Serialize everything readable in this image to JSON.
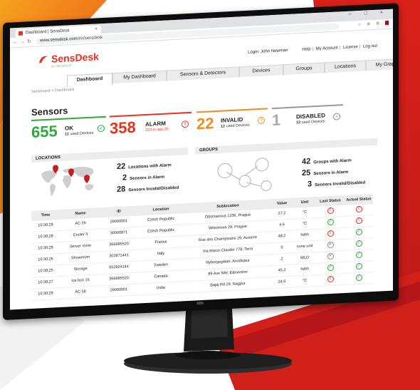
{
  "browser": {
    "tab_title": "Dashboard | SensDesk",
    "url_host": "www.sensdesk.com",
    "url_path": "/en/sensdesk",
    "window_controls": "– □ ×",
    "extensions": "☆ ⊕ ⚙"
  },
  "header": {
    "brand": "SensDesk",
    "tagline": "BY HW GROUP",
    "login_text": "Login: John Newman",
    "links": [
      "Help",
      "My Account",
      "License",
      "Log out"
    ]
  },
  "tabs": [
    "Dashboard",
    "My Dashboard",
    "Sensors & Detectors",
    "Devices",
    "Groups",
    "Locations",
    "My Graph"
  ],
  "breadcrumb": "Sensboard > Dashboard",
  "sensors": {
    "title": "Sensors",
    "ok": {
      "count": "655",
      "label": "OK",
      "sub_num": "11",
      "sub_text": "used Devices"
    },
    "alarm": {
      "count": "358",
      "label": "ALARM",
      "sub": "223 in last 2h"
    },
    "invalid": {
      "count": "22",
      "label": "INVALID",
      "sub_num": "12",
      "sub_text": "used Devices"
    },
    "disabled": {
      "count": "1",
      "label": "DISABLED",
      "sub_num": "12",
      "sub_text": "used Devices"
    }
  },
  "locations": {
    "title": "LOCATIONS",
    "stats": [
      {
        "n": "22",
        "text": "Locations with Alarm"
      },
      {
        "n": "2",
        "text": "Sensors in Alarm"
      },
      {
        "n": "28",
        "text": "Sensors Invalid/Disabled"
      }
    ]
  },
  "groups": {
    "title": "GROUPS",
    "stats": [
      {
        "n": "42",
        "text": "Groups with Alarm"
      },
      {
        "n": "25",
        "text": "Sensors in Alarm"
      },
      {
        "n": "3",
        "text": "Sensors Invalid/Disabled"
      }
    ]
  },
  "table": {
    "columns": [
      "Time",
      "Name",
      "ID",
      "Location",
      "Sublocation",
      "Value",
      "Unit",
      "Last Status",
      "Actual Status"
    ],
    "rows": [
      {
        "time": "10:30:29",
        "name": "AC 59",
        "id": "29000001",
        "location": "Czech Republic",
        "sub": "Ottomanova 1336, Prague",
        "value": "27.2",
        "unit": "°C",
        "last": "alarm",
        "actual": "alarm"
      },
      {
        "time": "10:30:28",
        "name": "Cooler 5",
        "id": "30000871",
        "location": "Czech Republic",
        "sub": "Wilsonova 29, Prague",
        "value": "4.6",
        "unit": "°C",
        "last": "ok",
        "actual": "alarm"
      },
      {
        "time": "10:30:29",
        "name": "Server room",
        "id": "366985520",
        "location": "France",
        "sub": "Rue des Champsians 29, Auxerre",
        "value": "48.2",
        "unit": "%Rh",
        "last": "alarm",
        "actual": "ok"
      },
      {
        "time": "10:30:26",
        "name": "Showroom",
        "id": "302871441",
        "location": "Italy",
        "sub": "Via Marco Claudio 778, Terni",
        "value": "0",
        "unit": "none unit",
        "last": "disabled",
        "actual": "ok"
      },
      {
        "time": "10:30:25",
        "name": "Storage",
        "id": "652924144",
        "location": "Sweden",
        "sub": "Nyborgsgatan, Arvidsjaur",
        "value": "2",
        "unit": "WLD",
        "last": "disabled",
        "actual": "ok"
      },
      {
        "time": "10:30:27",
        "name": "Ice box 15",
        "id": "366985520",
        "location": "Canada",
        "sub": "89 Ave NW, Edmonton",
        "value": "45.3",
        "unit": "%Rh",
        "last": "ok",
        "actual": "ok"
      },
      {
        "time": "10:30:29",
        "name": "AC 58",
        "id": "29000001",
        "location": "India",
        "sub": "Bajaj Rd 29, Nagpur",
        "value": "24.6",
        "unit": "°C",
        "last": "alarm",
        "actual": "ok"
      }
    ]
  },
  "colors": {
    "ok": "#2eaa3c",
    "alarm": "#e8321e",
    "invalid": "#f08c1e",
    "disabled": "#888888",
    "brand": "#e8321e"
  }
}
